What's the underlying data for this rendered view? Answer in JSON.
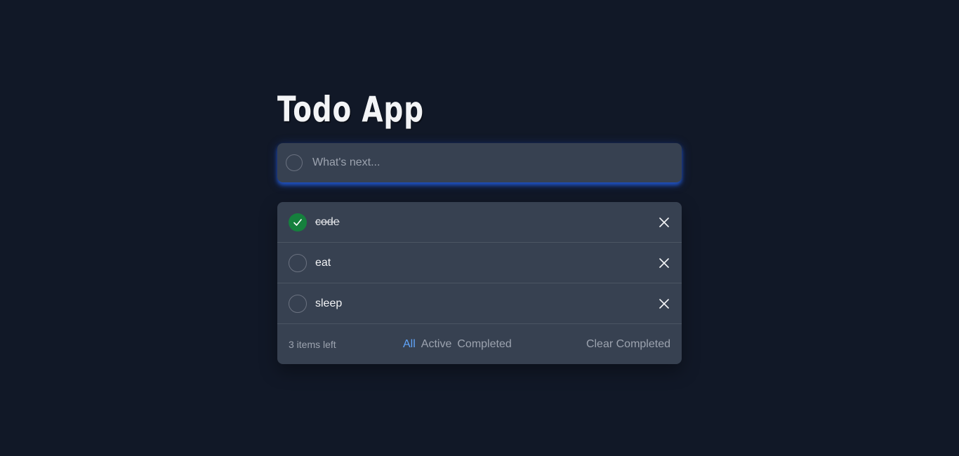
{
  "app": {
    "title": "Todo App"
  },
  "new_todo": {
    "placeholder": "What's next..."
  },
  "todos": [
    {
      "label": "code",
      "completed": true
    },
    {
      "label": "eat",
      "completed": false
    },
    {
      "label": "sleep",
      "completed": false
    }
  ],
  "footer": {
    "items_left": "3 items left",
    "filters": [
      "All",
      "Active",
      "Completed"
    ],
    "active_filter": "All",
    "clear_label": "Clear Completed"
  },
  "icons": {
    "check": "check-icon",
    "delete": "close-icon"
  },
  "colors": {
    "background": "#111827",
    "card": "#374151",
    "accent": "#60a5fa",
    "completed": "#15803d",
    "input_glow": "#2563eb"
  }
}
